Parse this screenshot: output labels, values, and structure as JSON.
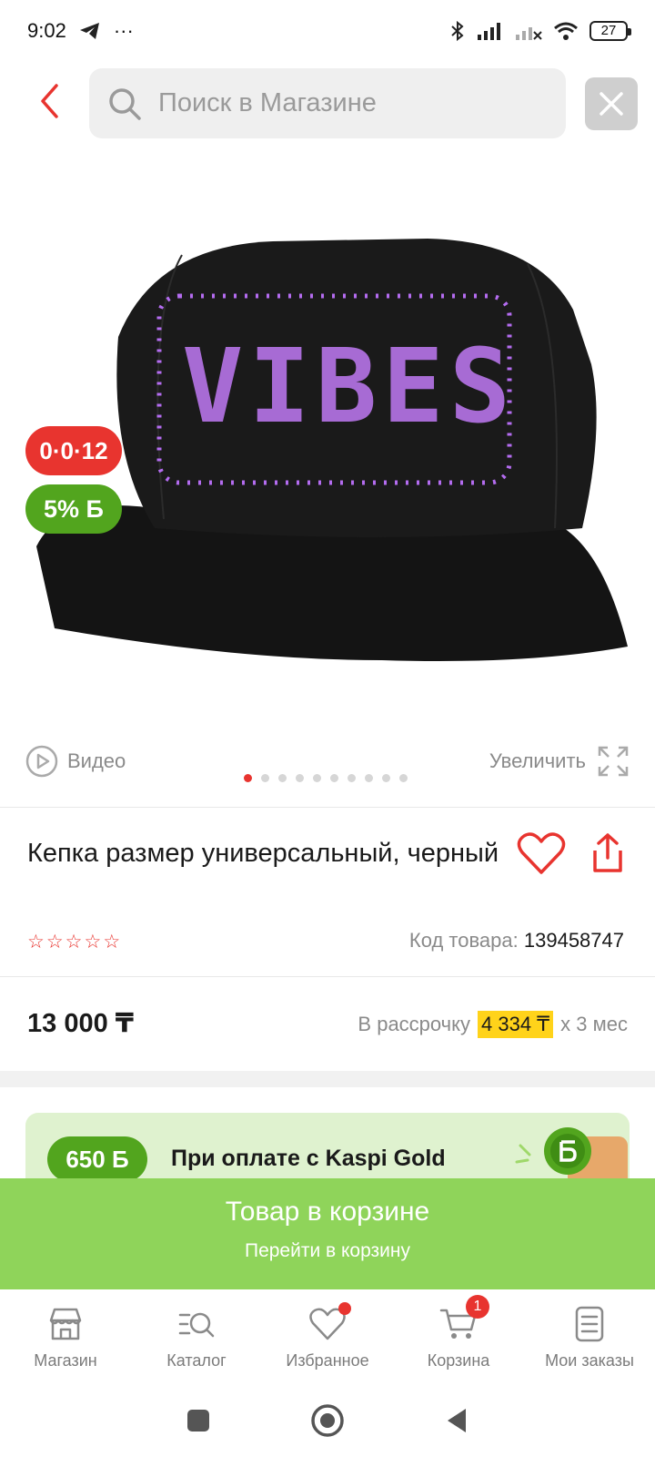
{
  "status_bar": {
    "time": "9:02",
    "more": "···",
    "battery": "27"
  },
  "search": {
    "placeholder": "Поиск в Магазине"
  },
  "image": {
    "timer_badge": "0·0·12",
    "bonus_badge": "5% Б",
    "hat_text": "VIBES",
    "video_label": "Видео",
    "zoom_label": "Увеличить",
    "dots": 10,
    "active_dot": 0
  },
  "product": {
    "title": "Кепка размер универсальный, черный",
    "rating": 0,
    "rating_max": 5,
    "sku_label": "Код товара:",
    "sku_value": "139458747",
    "price": "13 000 ₸",
    "installment_label": "В рассрочку",
    "installment_amount": "4 334 ₸",
    "installment_term": "х 3 мес"
  },
  "promo": {
    "badge": "650 Б",
    "text": "При оплате с Kaspi Gold"
  },
  "cart_bar": {
    "title": "Товар в корзине",
    "subtitle": "Перейти в корзину",
    "color": "#8fd45a"
  },
  "nav": {
    "items": [
      {
        "label": "Магазин",
        "icon": "shop-icon"
      },
      {
        "label": "Каталог",
        "icon": "catalog-search-icon"
      },
      {
        "label": "Избранное",
        "icon": "heart-icon",
        "dot": true
      },
      {
        "label": "Корзина",
        "icon": "cart-icon",
        "count": "1"
      },
      {
        "label": "Мои заказы",
        "icon": "orders-icon"
      }
    ]
  },
  "colors": {
    "accent": "#e8342f",
    "bonus_green": "#52a51e",
    "highlight": "#ffd31a"
  }
}
